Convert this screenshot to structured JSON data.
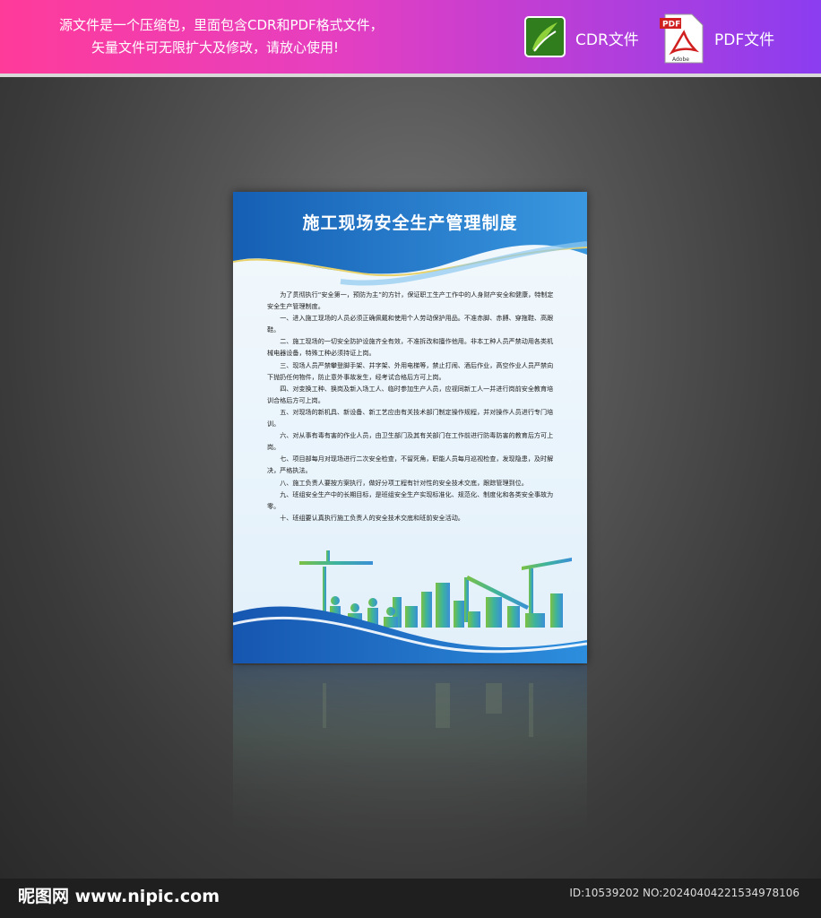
{
  "banner": {
    "line1": "源文件是一个压缩包，里面包含CDR和PDF格式文件，",
    "line2": "矢量文件可无限扩大及修改，请放心使用!",
    "cdr_label": "CDR文件",
    "pdf_label": "PDF文件",
    "pdf_icon_text": "PDF",
    "pdf_icon_sub": "Adobe"
  },
  "board": {
    "title": "施工现场安全生产管理制度",
    "paragraphs": [
      "为了贯彻执行“安全第一，预防为主”的方针，保证职工生产工作中的人身财产安全和健康，特制定安全生产管理制度。",
      "一、进入施工现场的人员必须正确佩戴和使用个人劳动保护用品。不准赤脚、赤膊、穿拖鞋、高跟鞋。",
      "二、施工现场的一切安全防护设施齐全有效，不准拆改和擅作他用。非本工种人员严禁动用各类机械电器设备，特殊工种必须持证上岗。",
      "三、现场人员严禁攀登脚手架、井字架、外用电梯等，禁止打闹、酒后作业，高空作业人员严禁向下抛扔任何物件，防止意外事故发生，经考试合格后方可上岗。",
      "四、对变换工种、换岗及新入场工人、临时参加生产人员，应视同新工人一并进行岗前安全教育培训合格后方可上岗。",
      "五、对现场的新机具、新设备、新工艺应由有关技术部门制定操作规程，并对操作人员进行专门培训。",
      "六、对从事有毒有害的作业人员，由卫生部门及其有关部门在工作前进行防毒防害的教育后方可上岗。",
      "七、项目部每月对现场进行二次安全检查，不留死角，职能人员每月巡视检查，发现隐患，及时解决，严格执法。",
      "八、施工负责人要按方案执行，做好分项工程有针对性的安全技术交底，跟踪管理到位。",
      "九、班组安全生产中的长期目标，是班组安全生产实现标准化、规范化、制度化和各类安全事故为零。",
      "十、班组要认真执行施工负责人的安全技术交底和班前安全活动。"
    ]
  },
  "footer": {
    "logo": "昵图网 www.nipic.com",
    "id_text": "ID:10539202 NO:20240404221534978106"
  },
  "colors": {
    "banner_left": "#ff3b9a",
    "banner_right": "#8b3df0",
    "board_blue": "#1f6fc4",
    "board_accent": "#2fb5a3"
  }
}
